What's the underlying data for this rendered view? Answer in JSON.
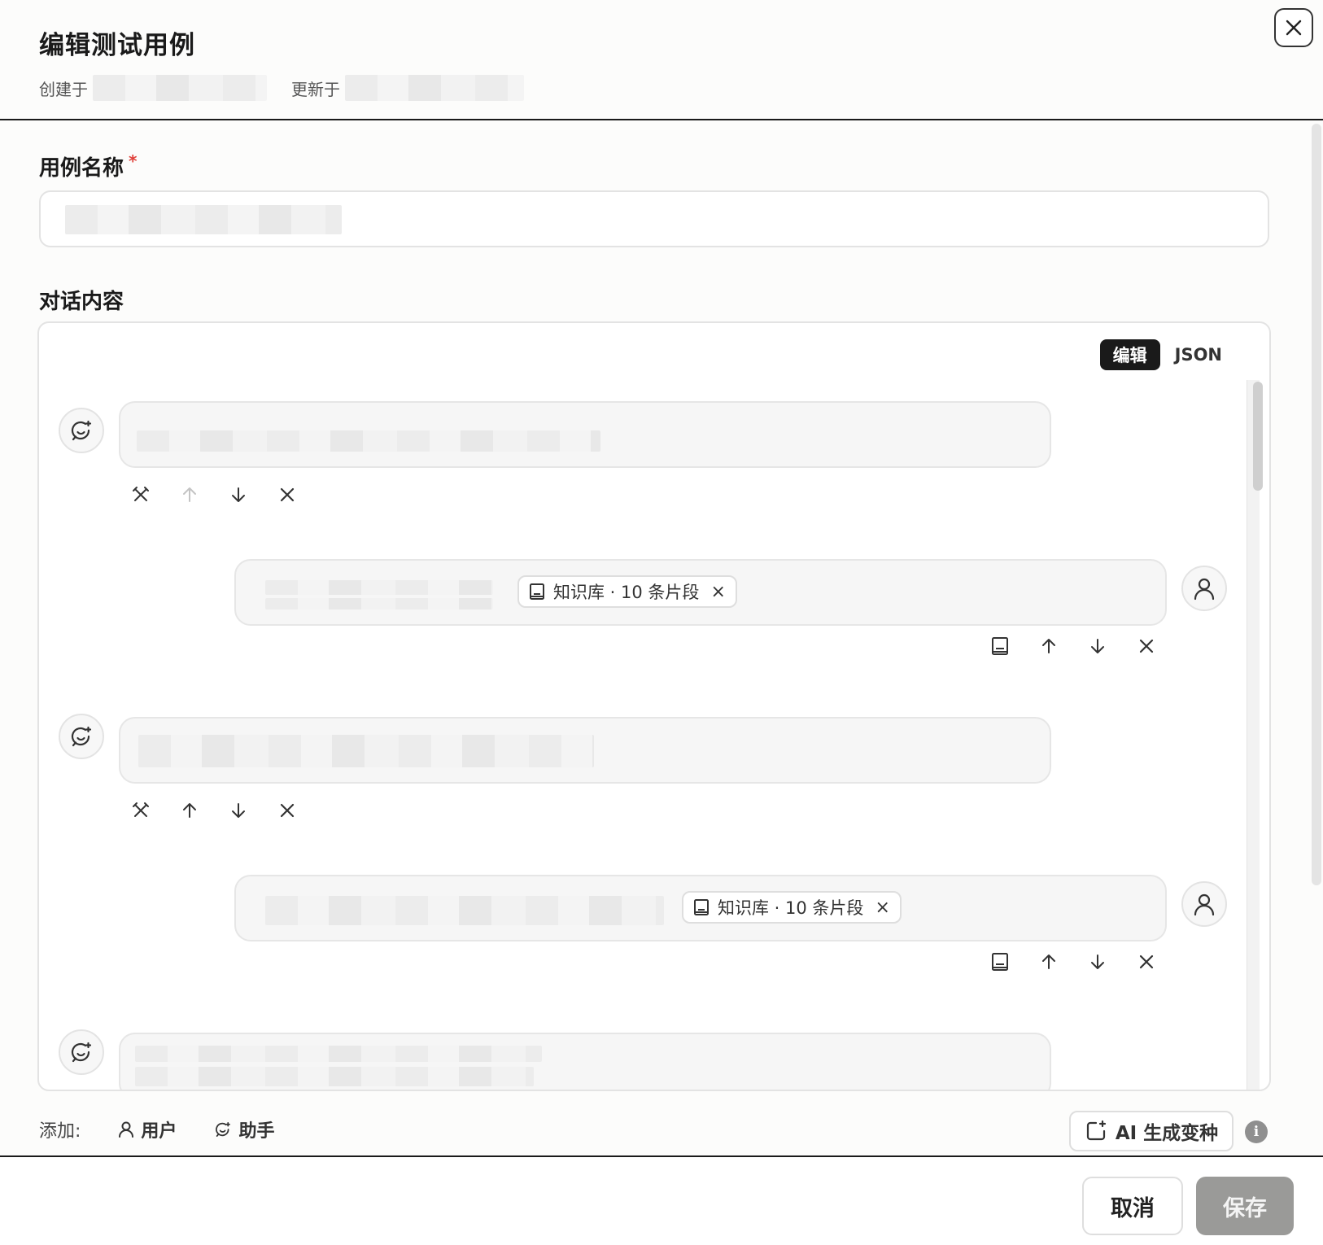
{
  "dialog": {
    "title": "编辑测试用例",
    "created_label": "创建于",
    "updated_label": "更新于"
  },
  "form": {
    "name_label": "用例名称",
    "required_mark": "*",
    "conversation_label": "对话内容"
  },
  "mode_toggle": {
    "edit": "编辑",
    "json": "JSON",
    "active": "编辑"
  },
  "messages": [
    {
      "role": "assistant",
      "actions": [
        "tool-icon",
        "arrow-up-icon",
        "arrow-down-icon",
        "close-icon"
      ],
      "move_up_disabled": true
    },
    {
      "role": "user",
      "chip": "知识库 · 10 条片段",
      "chip_close": "×",
      "actions": [
        "book-icon",
        "arrow-up-icon",
        "arrow-down-icon",
        "close-icon"
      ]
    },
    {
      "role": "assistant",
      "actions": [
        "tool-icon",
        "arrow-up-icon",
        "arrow-down-icon",
        "close-icon"
      ],
      "move_up_disabled": false
    },
    {
      "role": "user",
      "chip": "知识库 · 10 条片段",
      "chip_close": "×",
      "actions": [
        "book-icon",
        "arrow-up-icon",
        "arrow-down-icon",
        "close-icon"
      ]
    },
    {
      "role": "assistant"
    }
  ],
  "add_row": {
    "label": "添加:",
    "user": "用户",
    "assistant": "助手",
    "ai_variant": "AI 生成变种",
    "info": "i"
  },
  "footer": {
    "cancel": "取消",
    "save": "保存"
  },
  "colors": {
    "required": "#e0403a",
    "toggle_active_bg": "#1a1a1a",
    "save_disabled_bg": "#9a9a98"
  }
}
